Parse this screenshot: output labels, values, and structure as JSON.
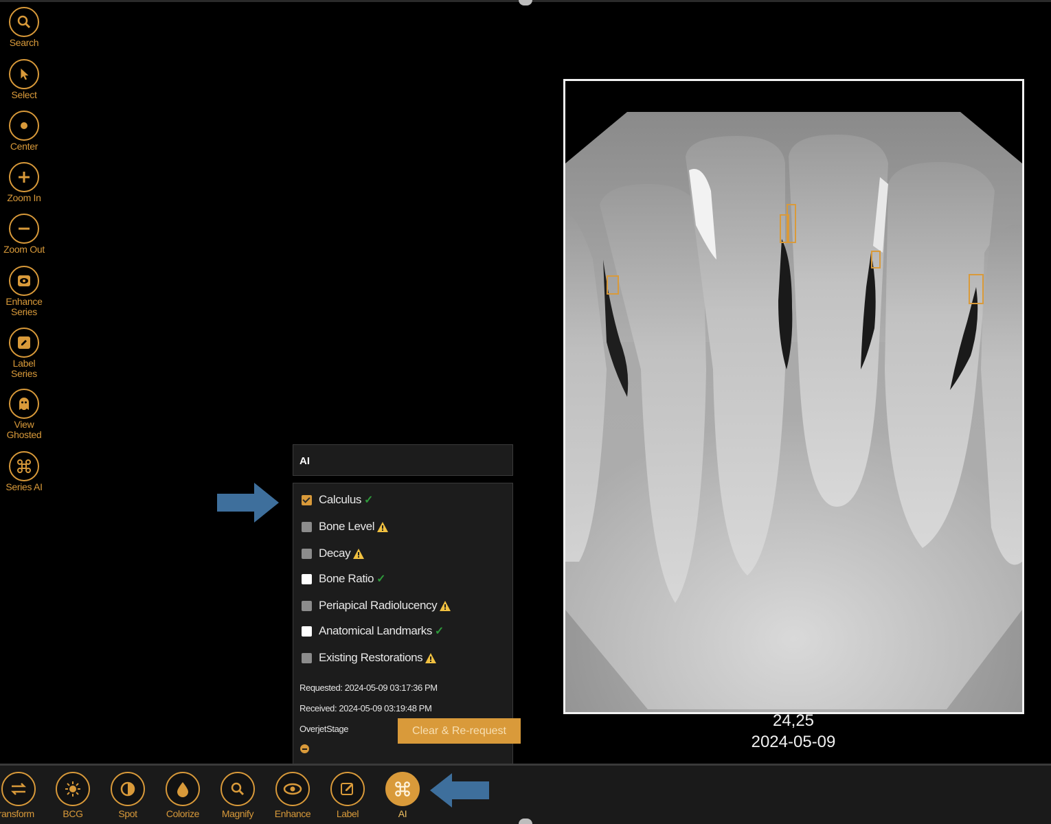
{
  "left_toolbar": [
    {
      "label": "Search",
      "icon": "search-icon"
    },
    {
      "label": "Select",
      "icon": "pointer-icon"
    },
    {
      "label": "Center",
      "icon": "center-dot-icon"
    },
    {
      "label": "Zoom In",
      "icon": "plus-icon"
    },
    {
      "label": "Zoom Out",
      "icon": "minus-icon"
    },
    {
      "label": "Enhance Series",
      "icon": "eye-box-icon"
    },
    {
      "label": "Label Series",
      "icon": "edit-box-icon"
    },
    {
      "label": "View Ghosted",
      "icon": "ghost-icon"
    },
    {
      "label": "Series AI",
      "icon": "ai-command-icon"
    }
  ],
  "ai_panel": {
    "title": "AI",
    "options": [
      {
        "label": "Calculus",
        "state": "checked",
        "status": "ok"
      },
      {
        "label": "Bone Level",
        "state": "gray",
        "status": "warning"
      },
      {
        "label": "Decay",
        "state": "gray",
        "status": "warning"
      },
      {
        "label": "Bone Ratio",
        "state": "white",
        "status": "ok"
      },
      {
        "label": "Periapical Radiolucency",
        "state": "gray",
        "status": "warning"
      },
      {
        "label": "Anatomical Landmarks",
        "state": "white",
        "status": "ok"
      },
      {
        "label": "Existing Restorations",
        "state": "gray",
        "status": "warning"
      }
    ],
    "requested": "Requested: 2024-05-09 03:17:36 PM",
    "received": "Received: 2024-05-09 03:19:48 PM",
    "stage": "OverjetStage",
    "clear_button": "Clear & Re-request"
  },
  "xray": {
    "teeth": "24,25",
    "date": "2024-05-09"
  },
  "bottom_toolbar": [
    {
      "label": "Transform",
      "icon": "transform-icon"
    },
    {
      "label": "BCG",
      "icon": "brightness-icon"
    },
    {
      "label": "Spot",
      "icon": "contrast-icon"
    },
    {
      "label": "Colorize",
      "icon": "drop-icon"
    },
    {
      "label": "Magnify",
      "icon": "magnify-icon"
    },
    {
      "label": "Enhance",
      "icon": "eye-icon"
    },
    {
      "label": "Label",
      "icon": "edit-icon"
    },
    {
      "label": "AI",
      "icon": "ai-command-icon",
      "active": true
    }
  ],
  "colors": {
    "accent": "#d99a3a",
    "ok": "#2e9a3b",
    "warning": "#f0c040",
    "arrow": "#3e6f9c"
  }
}
